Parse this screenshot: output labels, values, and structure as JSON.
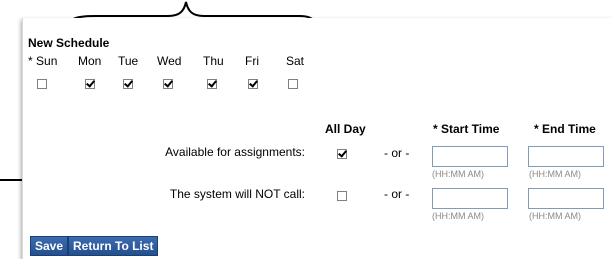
{
  "schedule": {
    "title": "New Schedule",
    "days": [
      {
        "label": "Sun",
        "required": true,
        "checked": false
      },
      {
        "label": "Mon",
        "required": false,
        "checked": true
      },
      {
        "label": "Tue",
        "required": false,
        "checked": true
      },
      {
        "label": "Wed",
        "required": false,
        "checked": true
      },
      {
        "label": "Thu",
        "required": false,
        "checked": true
      },
      {
        "label": "Fri",
        "required": false,
        "checked": true
      },
      {
        "label": "Sat",
        "required": false,
        "checked": false
      }
    ],
    "required_marker": "*"
  },
  "availability": {
    "headers": {
      "all_day": "All Day",
      "start_time": "* Start Time",
      "end_time": "* End Time"
    },
    "rows": [
      {
        "label": "Available for assignments:",
        "all_day_checked": true,
        "separator": "- or -",
        "start_placeholder": "(HH:MM AM)",
        "end_placeholder": "(HH:MM AM)",
        "start_value": "",
        "end_value": ""
      },
      {
        "label": "The system will NOT call:",
        "all_day_checked": false,
        "separator": "- or -",
        "start_placeholder": "(HH:MM AM)",
        "end_placeholder": "(HH:MM AM)",
        "start_value": "",
        "end_value": ""
      }
    ]
  },
  "buttons": {
    "save": "Save",
    "return": "Return To List"
  },
  "colors": {
    "button_bg": "#2d5c9f",
    "input_border": "#7f9db9",
    "hint_text": "#8a8a8a"
  }
}
